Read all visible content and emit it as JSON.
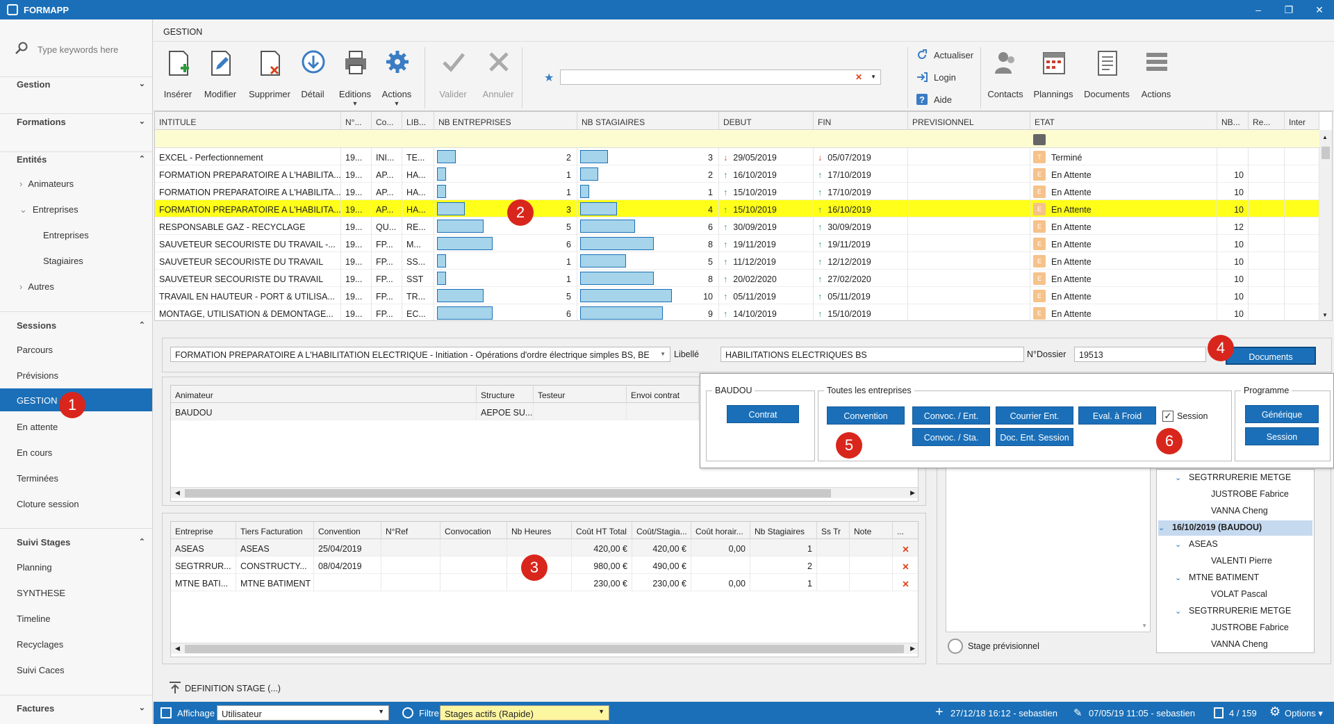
{
  "app": {
    "title": "FORMAPP"
  },
  "sidebar": {
    "search_placeholder": "Type keywords here",
    "groups": {
      "gestion": "Gestion",
      "formations": "Formations",
      "entites": "Entités",
      "sessions": "Sessions",
      "suivi_stages": "Suivi Stages",
      "factures": "Factures"
    },
    "entites_items": {
      "animateurs": "Animateurs",
      "entreprises": "Entreprises",
      "entreprises_sub": "Entreprises",
      "stagiaires": "Stagiaires",
      "autres": "Autres"
    },
    "sessions_items": [
      "Parcours",
      "Prévisions",
      "GESTION",
      "En attente",
      "En cours",
      "Terminées",
      "Cloture session"
    ],
    "suivi_items": [
      "Planning",
      "SYNTHESE",
      "Timeline",
      "Recyclages",
      "Suivi Caces"
    ]
  },
  "header": {
    "title": "GESTION"
  },
  "toolbar": {
    "inserer": "Insérer",
    "modifier": "Modifier",
    "supprimer": "Supprimer",
    "detail": "Détail",
    "editions": "Editions",
    "actions": "Actions",
    "valider": "Valider",
    "annuler": "Annuler",
    "actualiser": "Actualiser",
    "login": "Login",
    "aide": "Aide",
    "contacts": "Contacts",
    "plannings": "Plannings",
    "documents": "Documents",
    "actions2": "Actions"
  },
  "grid": {
    "columns": [
      "INTITULE",
      "N°...",
      "Co...",
      "LIB...",
      "NB ENTREPRISES",
      "NB STAGIAIRES",
      "DEBUT",
      "FIN",
      "PREVISIONNEL",
      "ETAT",
      "NB...",
      "Re...",
      "Inter"
    ],
    "rows": [
      {
        "intitule": "EXCEL - Perfectionnement",
        "no": "19...",
        "co": "INI...",
        "lib": "TE...",
        "nbe": 2,
        "nbs": 3,
        "debut": "29/05/2019",
        "fin": "05/07/2019",
        "dir": "down",
        "etat_b": "T",
        "etat": "Terminé",
        "nb": "",
        "sel": false
      },
      {
        "intitule": "FORMATION PREPARATOIRE A L'HABILITA...",
        "no": "19...",
        "co": "AP...",
        "lib": "HA...",
        "nbe": 1,
        "nbs": 2,
        "debut": "16/10/2019",
        "fin": "17/10/2019",
        "dir": "up",
        "etat_b": "E",
        "etat": "En Attente",
        "nb": "10",
        "sel": false
      },
      {
        "intitule": "FORMATION PREPARATOIRE A L'HABILITA...",
        "no": "19...",
        "co": "AP...",
        "lib": "HA...",
        "nbe": 1,
        "nbs": 1,
        "debut": "15/10/2019",
        "fin": "17/10/2019",
        "dir": "up",
        "etat_b": "E",
        "etat": "En Attente",
        "nb": "10",
        "sel": false
      },
      {
        "intitule": "FORMATION PREPARATOIRE A L'HABILITA...",
        "no": "19...",
        "co": "AP...",
        "lib": "HA...",
        "nbe": 3,
        "nbs": 4,
        "debut": "15/10/2019",
        "fin": "16/10/2019",
        "dir": "up",
        "etat_b": "E",
        "etat": "En Attente",
        "nb": "10",
        "sel": true
      },
      {
        "intitule": "RESPONSABLE GAZ - RECYCLAGE",
        "no": "19...",
        "co": "QU...",
        "lib": "RE...",
        "nbe": 5,
        "nbs": 6,
        "debut": "30/09/2019",
        "fin": "30/09/2019",
        "dir": "up",
        "etat_b": "E",
        "etat": "En Attente",
        "nb": "12",
        "sel": false
      },
      {
        "intitule": "SAUVETEUR SECOURISTE DU TRAVAIL -...",
        "no": "19...",
        "co": "FP...",
        "lib": "M...",
        "nbe": 6,
        "nbs": 8,
        "debut": "19/11/2019",
        "fin": "19/11/2019",
        "dir": "up",
        "etat_b": "E",
        "etat": "En Attente",
        "nb": "10",
        "sel": false
      },
      {
        "intitule": "SAUVETEUR SECOURISTE DU TRAVAIL",
        "no": "19...",
        "co": "FP...",
        "lib": "SS...",
        "nbe": 1,
        "nbs": 5,
        "debut": "11/12/2019",
        "fin": "12/12/2019",
        "dir": "up",
        "etat_b": "E",
        "etat": "En Attente",
        "nb": "10",
        "sel": false
      },
      {
        "intitule": "SAUVETEUR SECOURISTE DU TRAVAIL",
        "no": "19...",
        "co": "FP...",
        "lib": "SST",
        "nbe": 1,
        "nbs": 8,
        "debut": "20/02/2020",
        "fin": "27/02/2020",
        "dir": "up",
        "etat_b": "E",
        "etat": "En Attente",
        "nb": "10",
        "sel": false
      },
      {
        "intitule": "TRAVAIL EN HAUTEUR - PORT & UTILISA...",
        "no": "19...",
        "co": "FP...",
        "lib": "TR...",
        "nbe": 5,
        "nbs": 10,
        "debut": "05/11/2019",
        "fin": "05/11/2019",
        "dir": "up",
        "etat_b": "E",
        "etat": "En Attente",
        "nb": "10",
        "sel": false
      },
      {
        "intitule": "MONTAGE, UTILISATION & DEMONTAGE...",
        "no": "19...",
        "co": "FP...",
        "lib": "EC...",
        "nbe": 6,
        "nbs": 9,
        "debut": "14/10/2019",
        "fin": "15/10/2019",
        "dir": "up",
        "etat_b": "E",
        "etat": "En Attente",
        "nb": "10",
        "sel": false
      }
    ]
  },
  "detail": {
    "formation": "FORMATION PREPARATOIRE A L'HABILITATION ELECTRIQUE - Initiation - Opérations d'ordre électrique simples BS, BE",
    "libelle_label": "Libellé",
    "libelle_value": "HABILITATIONS ELECTRIQUES BS",
    "dossier_label": "N°Dossier",
    "dossier_value": "19513",
    "documents_btn": "Documents"
  },
  "animateurs": {
    "columns": [
      "Animateur",
      "Structure",
      "Testeur",
      "Envoi contrat"
    ],
    "rows": [
      {
        "animateur": "BAUDOU",
        "structure": "AEPOE SU...",
        "testeur": "",
        "envoi": ""
      }
    ]
  },
  "entreprises": {
    "columns": [
      "Entreprise",
      "Tiers Facturation",
      "Convention",
      "N°Ref",
      "Convocation",
      "Nb Heures",
      "Coût HT Total",
      "Coût/Stagia...",
      "Coût horair...",
      "Nb Stagiaires",
      "Ss Tr",
      "Note",
      "..."
    ],
    "rows": [
      {
        "entreprise": "ASEAS",
        "tiers": "ASEAS",
        "convention": "25/04/2019",
        "ref": "",
        "convocation": "",
        "heures": "",
        "total": "420,00 €",
        "stag": "420,00 €",
        "horaire": "0,00",
        "nb": "1"
      },
      {
        "entreprise": "SEGTRRUR...",
        "tiers": "CONSTRUCTY...",
        "convention": "08/04/2019",
        "ref": "",
        "convocation": "",
        "heures": "",
        "total": "980,00 €",
        "stag": "490,00 €",
        "horaire": "",
        "nb": "2"
      },
      {
        "entreprise": "MTNE BATI...",
        "tiers": "MTNE BATIMENT",
        "convention": "",
        "ref": "",
        "convocation": "",
        "heures": "",
        "total": "230,00 €",
        "stag": "230,00 €",
        "horaire": "0,00",
        "nb": "1"
      }
    ]
  },
  "popup": {
    "baudou_title": "BAUDOU",
    "contrat": "Contrat",
    "toutes_title": "Toutes les entreprises",
    "convention": "Convention",
    "convoc_ent": "Convoc. / Ent.",
    "courrier_ent": "Courrier Ent.",
    "eval_froid": "Eval. à Froid",
    "session_chk": "Session",
    "convoc_sta": "Convoc. / Sta.",
    "doc_ent_session": "Doc. Ent. Session",
    "programme_title": "Programme",
    "generique": "Générique",
    "session": "Session"
  },
  "tree": [
    {
      "level": 1,
      "text": "SEGTRRURERIE METGE",
      "exp": true
    },
    {
      "level": 2,
      "text": "JUSTROBE Fabrice"
    },
    {
      "level": 2,
      "text": "VANNA Cheng"
    },
    {
      "level": 0,
      "text": "16/10/2019 (BAUDOU)",
      "exp": true,
      "hl": true
    },
    {
      "level": 1,
      "text": "ASEAS",
      "exp": true
    },
    {
      "level": 2,
      "text": "VALENTI Pierre"
    },
    {
      "level": 1,
      "text": "MTNE BATIMENT",
      "exp": true
    },
    {
      "level": 2,
      "text": "VOLAT Pascal"
    },
    {
      "level": 1,
      "text": "SEGTRRURERIE METGE",
      "exp": true
    },
    {
      "level": 2,
      "text": "JUSTROBE Fabrice"
    },
    {
      "level": 2,
      "text": "VANNA Cheng"
    }
  ],
  "stage_prev": "Stage prévisionnel",
  "definition_stage": "DEFINITION STAGE (...)",
  "statusbar": {
    "affichage_label": "Affichage",
    "affichage_value": "Utilisateur",
    "filtre_label": "Filtre",
    "filtre_value": "Stages actifs (Rapide)",
    "created": "27/12/18 16:12 - sebastien",
    "modified": "07/05/19 11:05 - sebastien",
    "count": "4 / 159",
    "options": "Options"
  },
  "badges": [
    "1",
    "2",
    "3",
    "4",
    "5",
    "6"
  ],
  "colors": {
    "accent": "#1a6fb8",
    "selected_row": "#ffff1a",
    "badge": "#d9261c",
    "filter_row": "#fdfcd0"
  }
}
